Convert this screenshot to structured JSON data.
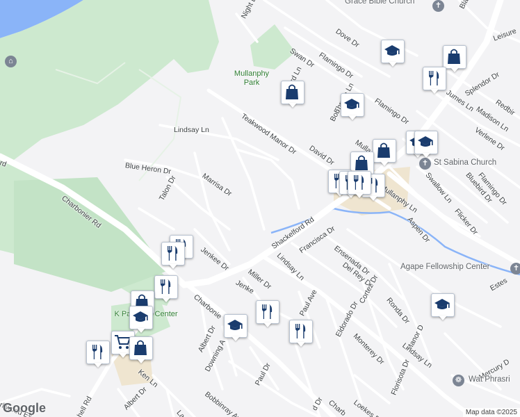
{
  "map": {
    "colors": {
      "background": "#f3f3f5",
      "park": "#c8e6c9",
      "water": "#8ab4f8",
      "road": "#ffffff",
      "major_road": "#ffffff",
      "marker_icon": "#1a3c6e"
    },
    "attribution": "Map data ©2025",
    "logo": "Google",
    "streets": [
      "Night Dr",
      "Dove Dr",
      "Swan Dr",
      "Flamingo Dr",
      "Thrush Ln",
      "Bob",
      "Flamingo Dr",
      "Splendor Dr",
      "Leisure",
      "Redbir",
      "Madison Ln",
      "Verlene Dr",
      "Jumes Ln",
      "Lindsay Ln",
      "Teakwood Manor Dr",
      "David Dr",
      "Mulla",
      "Blue Heron Dr",
      "Talon Dr",
      "Marrisa Dr",
      "Charbonier Rd",
      "Shackelford Rd",
      "Mullanphy Ln",
      "Swallow Ln",
      "Bluebird Dr",
      "Flamingo Dr",
      "Flicker Dr",
      "Aspen Dr",
      "Francisca Dr",
      "Ensenada Dr",
      "Del Rey Dr",
      "Cortez Dr",
      "Lindsay Ln",
      "Jenkee Dr",
      "Miller Dr",
      "Jenke",
      "Charbonie",
      "Paul Ave",
      "Estes",
      "Ronda Dr",
      "Manor D",
      "Eldorado Dr",
      "Monterey Dr",
      "Florisota Dr",
      "Lindsay Ln",
      "Mercury D",
      "Albert Dr",
      "Downing A",
      "Paul Dr",
      "Bobbinray Ave",
      "Loekes Dr",
      "Albert Dr",
      "La",
      "Ken Ln",
      "hell Rd",
      "rkwood Es",
      "rd",
      "Charb",
      "d Dr",
      "Black",
      "rd Ln"
    ],
    "parks": [
      {
        "name": "Mullanphy Park"
      },
      {
        "name": "K   Park Aqu    Center"
      }
    ],
    "places": [
      {
        "name": "Grace Bible Church",
        "icon": "church-icon"
      },
      {
        "name": "St Sabina Church",
        "icon": "church-icon"
      },
      {
        "name": "Agape Fellowship Center",
        "icon": "church-icon"
      },
      {
        "name": "Wat Phrasri",
        "icon": "temple-icon"
      },
      {
        "name": "",
        "icon": "museum-icon"
      }
    ],
    "markers": [
      {
        "type": "school",
        "icon": "graduation-cap-icon"
      },
      {
        "type": "shopping",
        "icon": "shopping-bag-icon"
      },
      {
        "type": "restaurant",
        "icon": "fork-knife-icon"
      },
      {
        "type": "shopping",
        "icon": "shopping-bag-icon"
      },
      {
        "type": "school",
        "icon": "graduation-cap-icon"
      },
      {
        "type": "school",
        "icon": "graduation-cap-icon"
      },
      {
        "type": "school",
        "icon": "graduation-cap-icon"
      },
      {
        "type": "shopping",
        "icon": "shopping-bag-icon"
      },
      {
        "type": "shopping",
        "icon": "shopping-bag-icon"
      },
      {
        "type": "restaurant",
        "icon": "fork-knife-icon"
      },
      {
        "type": "restaurant",
        "icon": "fork-knife-icon"
      },
      {
        "type": "restaurant",
        "icon": "fork-knife-icon"
      },
      {
        "type": "restaurant",
        "icon": "fork-knife-icon"
      },
      {
        "type": "restaurant",
        "icon": "fork-knife-icon"
      },
      {
        "type": "restaurant",
        "icon": "fork-knife-icon"
      },
      {
        "type": "restaurant",
        "icon": "fork-knife-icon"
      },
      {
        "type": "shopping",
        "icon": "shopping-bag-icon"
      },
      {
        "type": "school",
        "icon": "graduation-cap-icon"
      },
      {
        "type": "restaurant",
        "icon": "fork-knife-icon"
      },
      {
        "type": "school",
        "icon": "graduation-cap-icon"
      },
      {
        "type": "restaurant",
        "icon": "fork-knife-icon"
      },
      {
        "type": "school",
        "icon": "graduation-cap-icon"
      },
      {
        "type": "restaurant",
        "icon": "fork-knife-icon"
      },
      {
        "type": "grocery",
        "icon": "shopping-cart-icon"
      },
      {
        "type": "shopping",
        "icon": "shopping-bag-icon"
      }
    ]
  }
}
